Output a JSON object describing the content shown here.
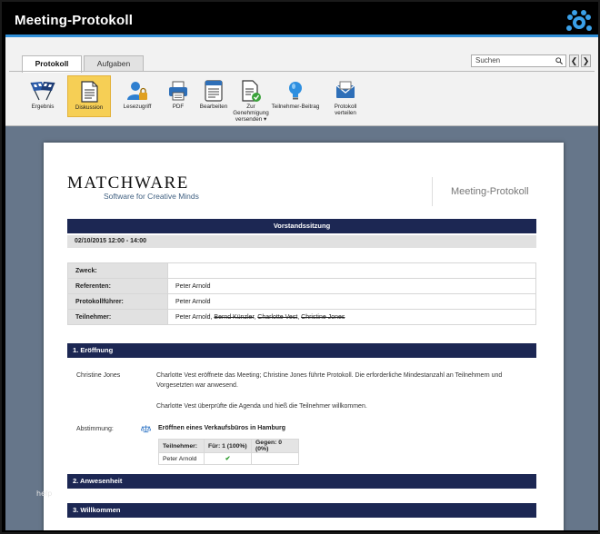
{
  "window": {
    "title": "Meeting-Protokoll"
  },
  "tabs": [
    {
      "label": "Protokoll",
      "active": true
    },
    {
      "label": "Aufgaben",
      "active": false
    }
  ],
  "search": {
    "placeholder": "Suchen",
    "prev": "❮",
    "next": "❯"
  },
  "toolbar": [
    {
      "label": "Ergebnis",
      "icon": "flags-icon"
    },
    {
      "label": "Diskussion",
      "icon": "document-icon",
      "active": true
    },
    {
      "label": "Lesezugriff",
      "icon": "user-lock-icon"
    },
    {
      "label": "PDF",
      "icon": "printer-icon"
    },
    {
      "label": "Bearbeiten",
      "icon": "edit-doc-icon"
    },
    {
      "label_lines": [
        "Zur",
        "Genehmigung",
        "versenden"
      ],
      "icon": "approval-icon",
      "dropdown": true
    },
    {
      "label": "Teilnehmer-Beitrag",
      "icon": "lightbulb-icon"
    },
    {
      "label_lines": [
        "Protokoll",
        "verteilen"
      ],
      "icon": "mail-icon"
    }
  ],
  "document": {
    "brand": "MATCHWARE",
    "brand_sub": "Software for Creative Minds",
    "doc_title": "Meeting-Protokoll",
    "meeting_title": "Vorstandssitzung",
    "datetime": "02/10/2015 12:00 - 14:00",
    "info": [
      {
        "key": "Zweck:",
        "value": ""
      },
      {
        "key": "Referenten:",
        "value": "Peter Arnold"
      },
      {
        "key": "Protokollführer:",
        "value": "Peter Arnold"
      },
      {
        "key": "Teilnehmer:",
        "value": "Peter Arnold,",
        "absent": [
          "Bernd Künzler",
          "Charlotte Vest",
          "Christine Jones"
        ]
      }
    ],
    "sections": [
      {
        "title": "1. Eröffnung"
      },
      {
        "title": "2. Anwesenheit"
      },
      {
        "title": "3. Willkommen"
      }
    ],
    "section1": {
      "speaker": "Christine Jones",
      "para1_line1": "Charlotte Vest eröffnete das Meeting; Christine Jones führte Protokoll. Die erforderliche Mindestanzahl an Teilnehmern und",
      "para1_line2": "Vorgesetzten war anwesend.",
      "para2": "Charlotte Vest überprüfte die Agenda und hieß die Teilnehmer willkommen.",
      "vote_label": "Abstimmung:",
      "vote_title": "Eröffnen eines Verkaufsbüros in Hamburg",
      "vote_headers": [
        "Teilnehmer:",
        "Für: 1 (100%)",
        "Gegen: 0 (0%)"
      ],
      "vote_rows": [
        {
          "name": "Peter Arnold",
          "for": "✔",
          "against": ""
        }
      ]
    }
  },
  "help": "help"
}
